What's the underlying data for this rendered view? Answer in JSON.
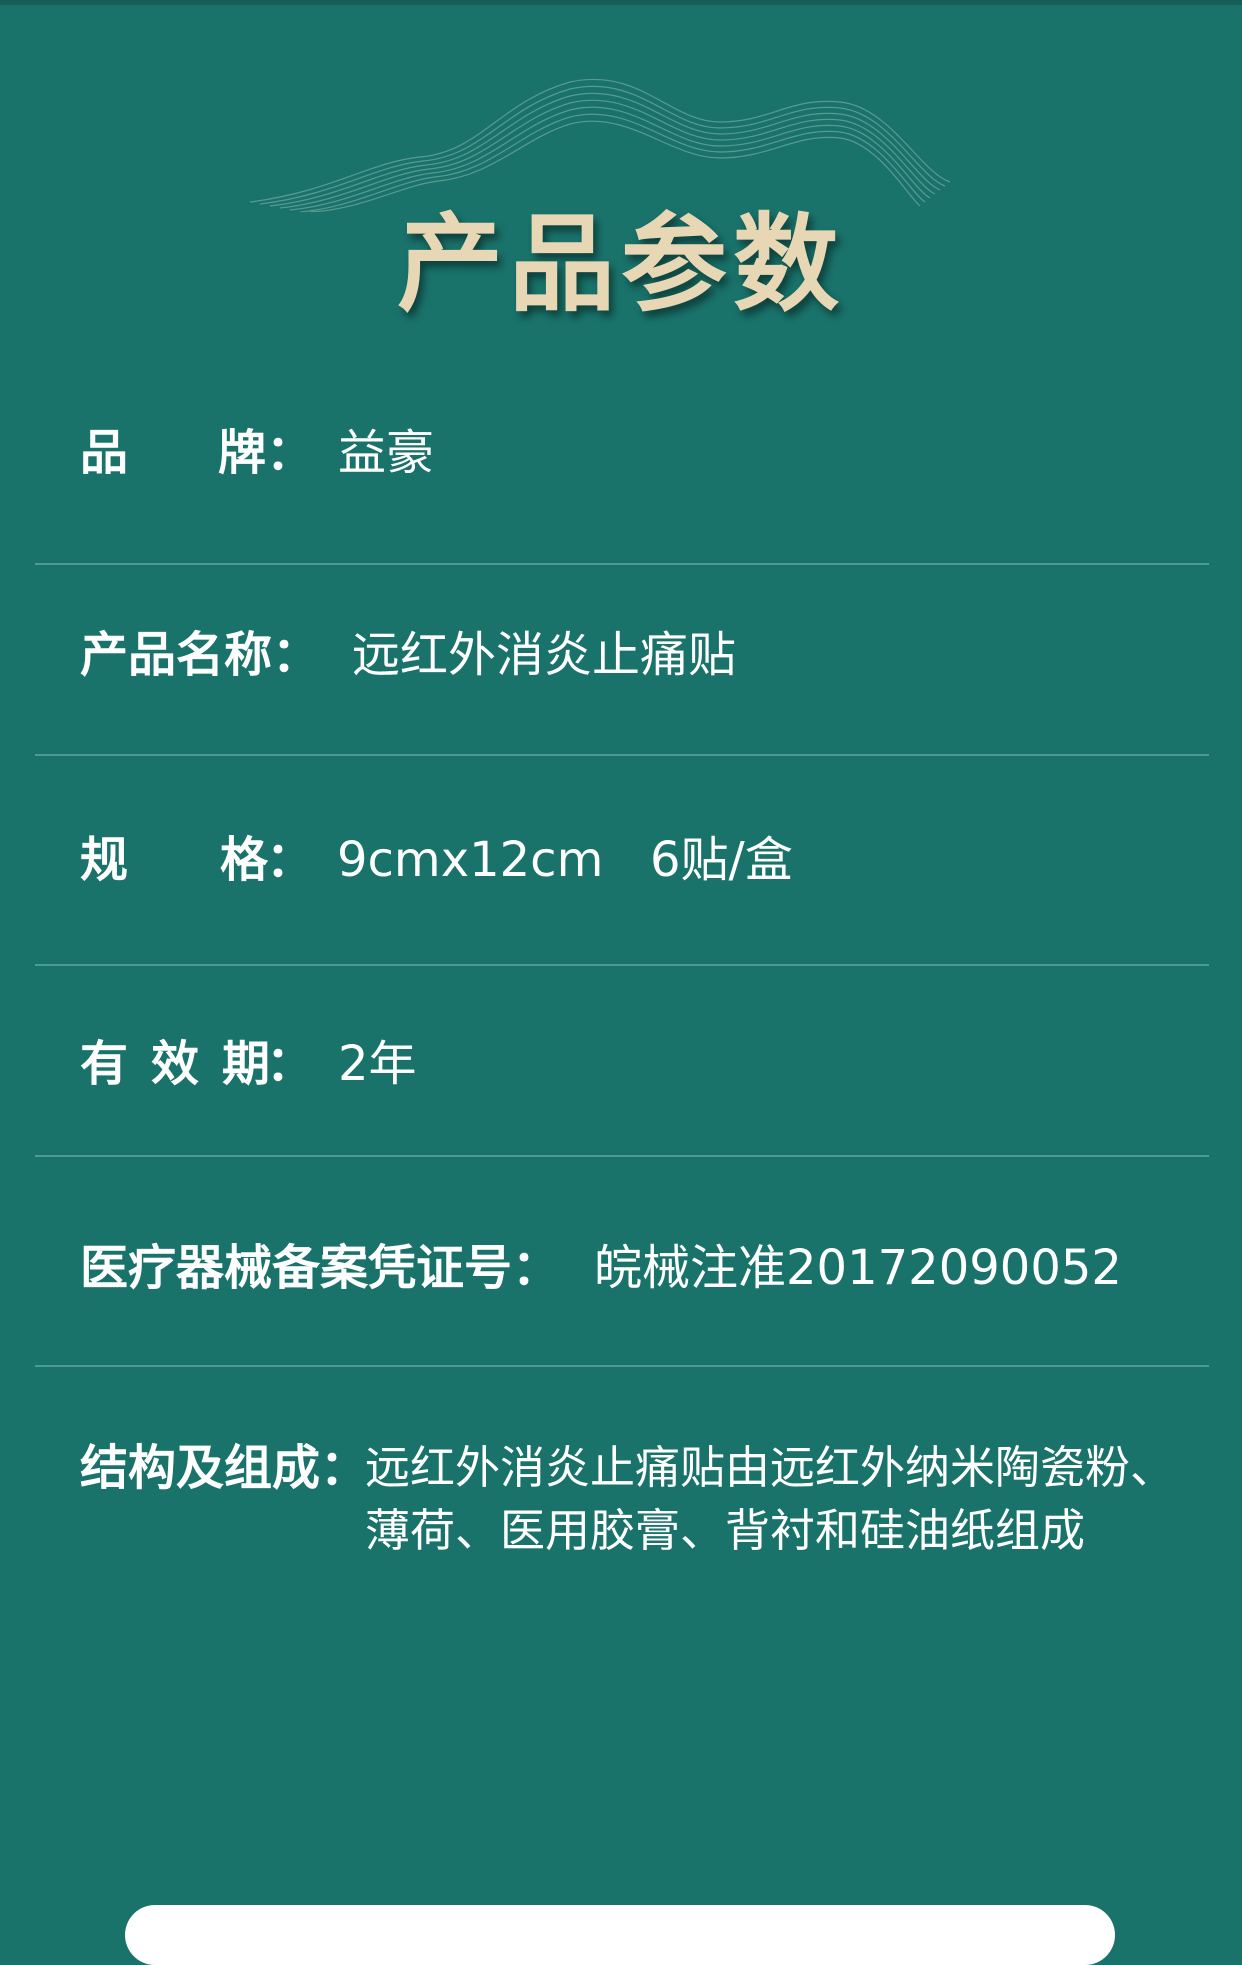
{
  "title": "产品参数",
  "rows": [
    {
      "label_a": "品",
      "label_b": "牌",
      "colon": "：",
      "value": "益豪"
    },
    {
      "label": "产品名称：",
      "value": "远红外消炎止痛贴"
    },
    {
      "label_a": "规",
      "label_b": "格",
      "colon": "：",
      "value_a": "9cmx12cm",
      "value_b": "6贴/盒"
    },
    {
      "label_a": "有",
      "label_b": "效",
      "label_c": "期",
      "colon": "：",
      "value": "2年"
    },
    {
      "label": "医疗器械备案凭证号：",
      "value": "皖械注准20172090052"
    },
    {
      "label": "结构及组成：",
      "value_line1": "远红外消炎止痛贴由远红外纳米陶瓷粉、",
      "value_line2": "薄荷、医用胶膏、背衬和硅油纸组成"
    }
  ],
  "colors": {
    "background": "#19736b",
    "title": "#e8d7b4",
    "text": "#ffffff",
    "divider": "#4d9a92"
  }
}
